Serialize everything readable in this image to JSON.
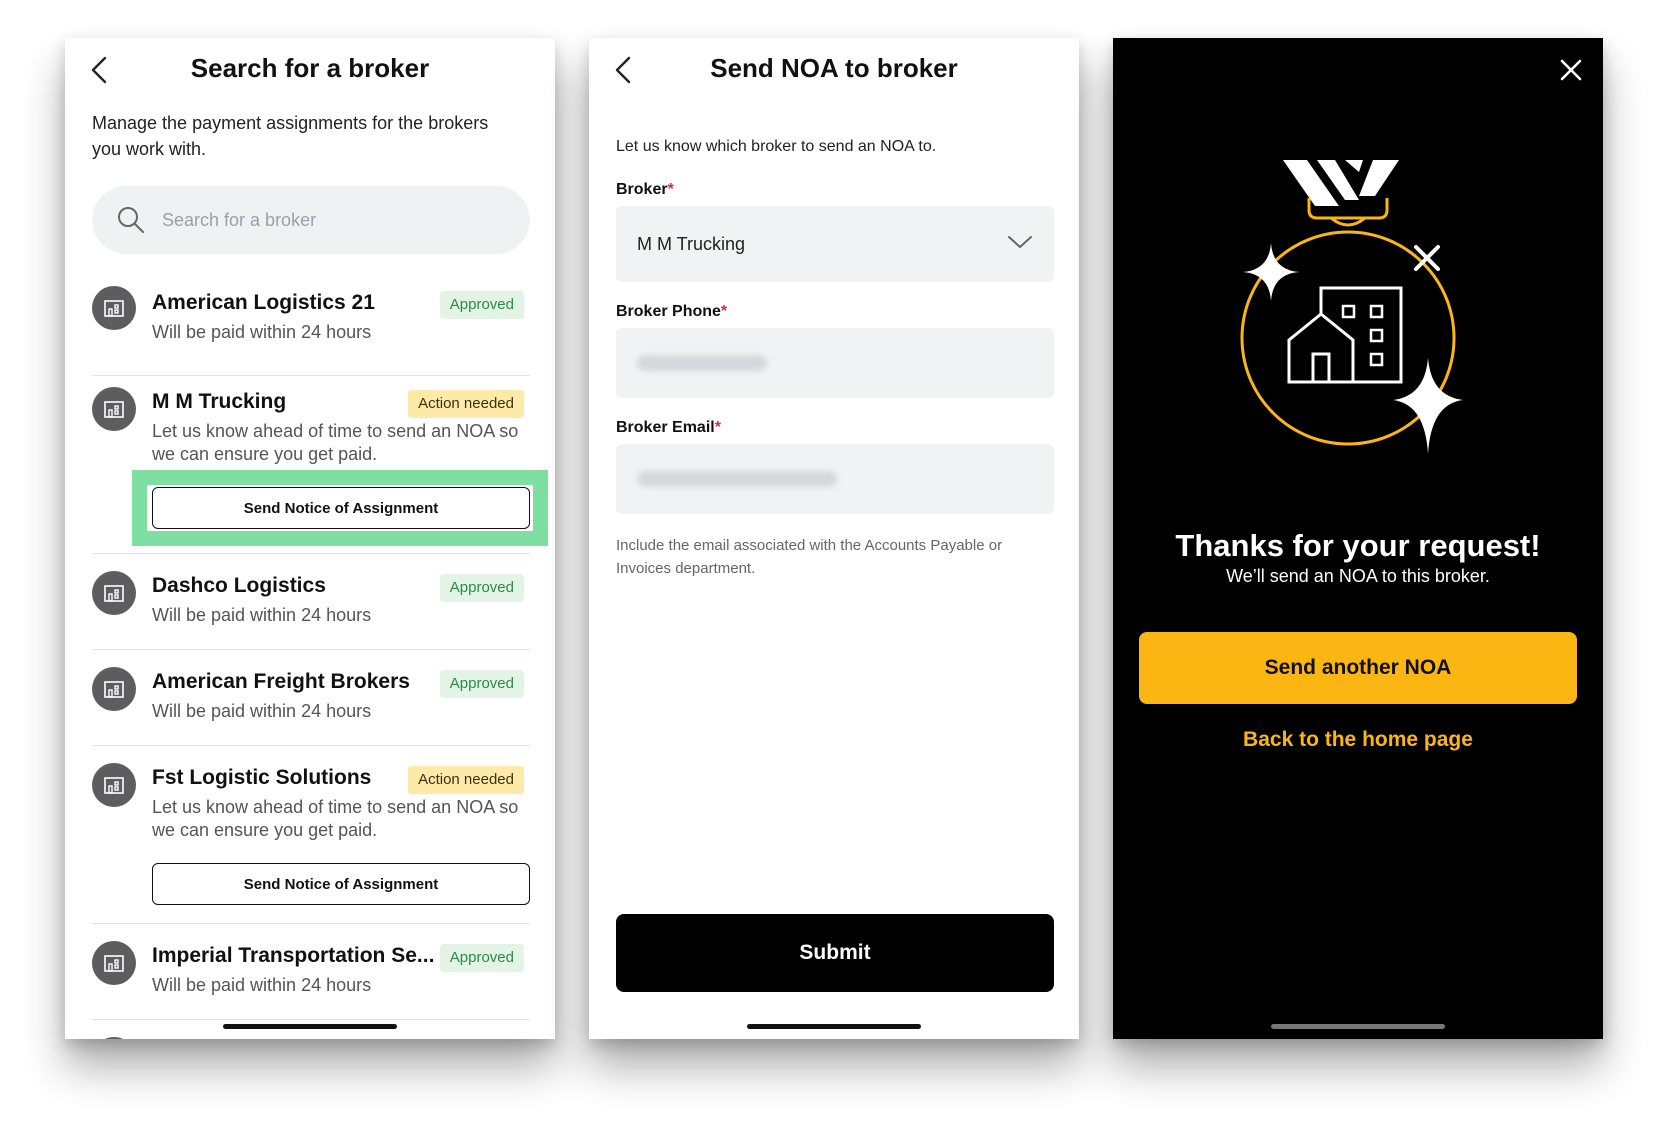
{
  "screen1": {
    "title": "Search for a broker",
    "intro": "Manage the payment assignments for the brokers you work with.",
    "search_placeholder": "Search for a broker",
    "brokers": [
      {
        "name": "American Logistics 21",
        "status": "Approved",
        "status_type": "approved",
        "subtitle": "Will be paid within 24 hours"
      },
      {
        "name": "M M Trucking",
        "status": "Action needed",
        "status_type": "action",
        "subtitle": "Let us know ahead of time to send an NOA so we can ensure you get paid.",
        "button": "Send Notice of Assignment"
      },
      {
        "name": "Dashco Logistics",
        "status": "Approved",
        "status_type": "approved",
        "subtitle": "Will be paid within 24 hours"
      },
      {
        "name": "American Freight Brokers",
        "status": "Approved",
        "status_type": "approved",
        "subtitle": "Will be paid within 24 hours"
      },
      {
        "name": "Fst Logistic Solutions",
        "status": "Action needed",
        "status_type": "action",
        "subtitle": "Let us know ahead of time to send an NOA so we can ensure you get paid.",
        "button": "Send Notice of Assignment"
      },
      {
        "name": "Imperial Transportation Se...",
        "status": "Approved",
        "status_type": "approved",
        "subtitle": "Will be paid within 24 hours"
      }
    ]
  },
  "screen2": {
    "title": "Send NOA to broker",
    "intro": "Let us know which broker to send an NOA to.",
    "broker_label": "Broker",
    "broker_value": "M M Trucking",
    "phone_label": "Broker Phone",
    "email_label": "Broker Email",
    "required_mark": "*",
    "help_text": "Include the email associated with the Accounts Payable or Invoices department.",
    "submit_label": "Submit"
  },
  "screen3": {
    "heading": "Thanks for your request!",
    "subheading": "We’ll send an NOA to this broker.",
    "primary_label": "Send another NOA",
    "link_label": "Back to the home page"
  },
  "colors": {
    "accent_yellow": "#fbb614",
    "approved_bg": "#e3f4e7",
    "approved_text": "#2b8a46",
    "action_bg": "#fde9a8",
    "highlight_green": "#7fdfa2",
    "required_red": "#e0243a"
  },
  "icons": [
    "chevron-left-icon",
    "search-icon",
    "building-icon",
    "chevron-down-icon",
    "close-icon",
    "medal-illustration"
  ]
}
